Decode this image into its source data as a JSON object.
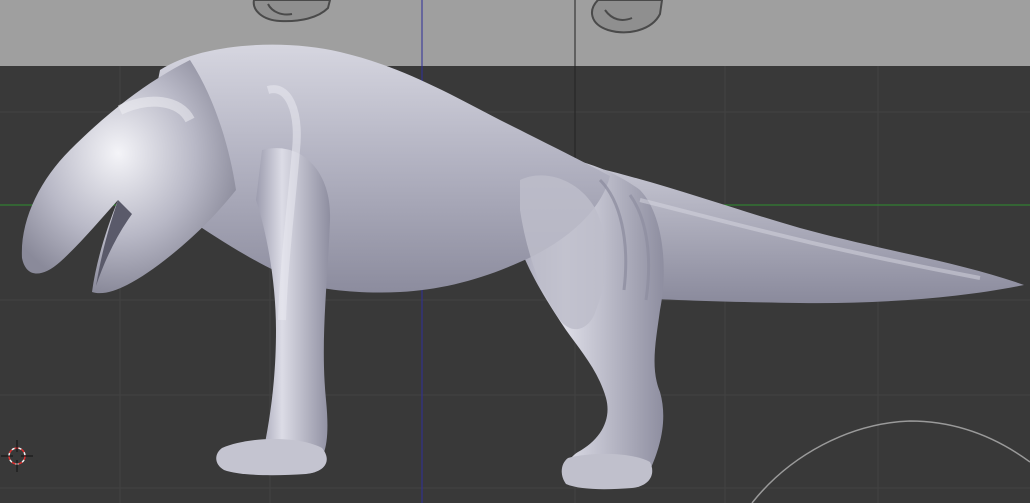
{
  "viewport": {
    "mode": "3d-viewport",
    "background_color": "#393939",
    "grid_color": "#444444",
    "reference_strip_color": "#9f9f9f",
    "x_axis_color": "#2f8f2f",
    "z_axis_color": "#2e2e9a",
    "cursor_icon": "3d-cursor-icon",
    "brush_icon": "brush-radius-circle-icon"
  },
  "model": {
    "name": "",
    "shading": "matcap-clay",
    "base_color": "#a9a9b7",
    "highlight_color": "#e6e6ee",
    "shadow_color": "#6e6e7e"
  }
}
